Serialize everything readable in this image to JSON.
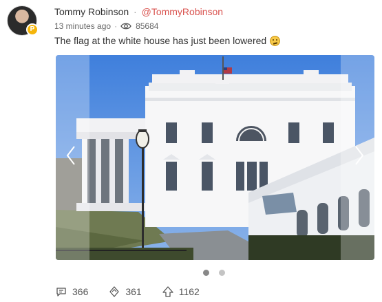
{
  "post": {
    "author": "Tommy Robinson",
    "separator": "·",
    "handle": "@TommyRobinson",
    "time": "13 minutes ago",
    "meta_dot": "·",
    "views": "85684",
    "text": "The flag at the white house has just been lowered",
    "badge_letter": "P"
  },
  "carousel": {
    "slides": 2,
    "active": 0
  },
  "actions": {
    "comments": "366",
    "reposts": "361",
    "upvotes": "1162"
  },
  "colors": {
    "handle": "#d9534f",
    "badge": "#f5b50a",
    "sky": "#5f93dd"
  },
  "icons": {
    "view": "eye-icon",
    "comment": "comment-icon",
    "repost": "repost-icon",
    "upvote": "upvote-icon",
    "prev": "chevron-left-icon",
    "next": "chevron-right-icon"
  }
}
